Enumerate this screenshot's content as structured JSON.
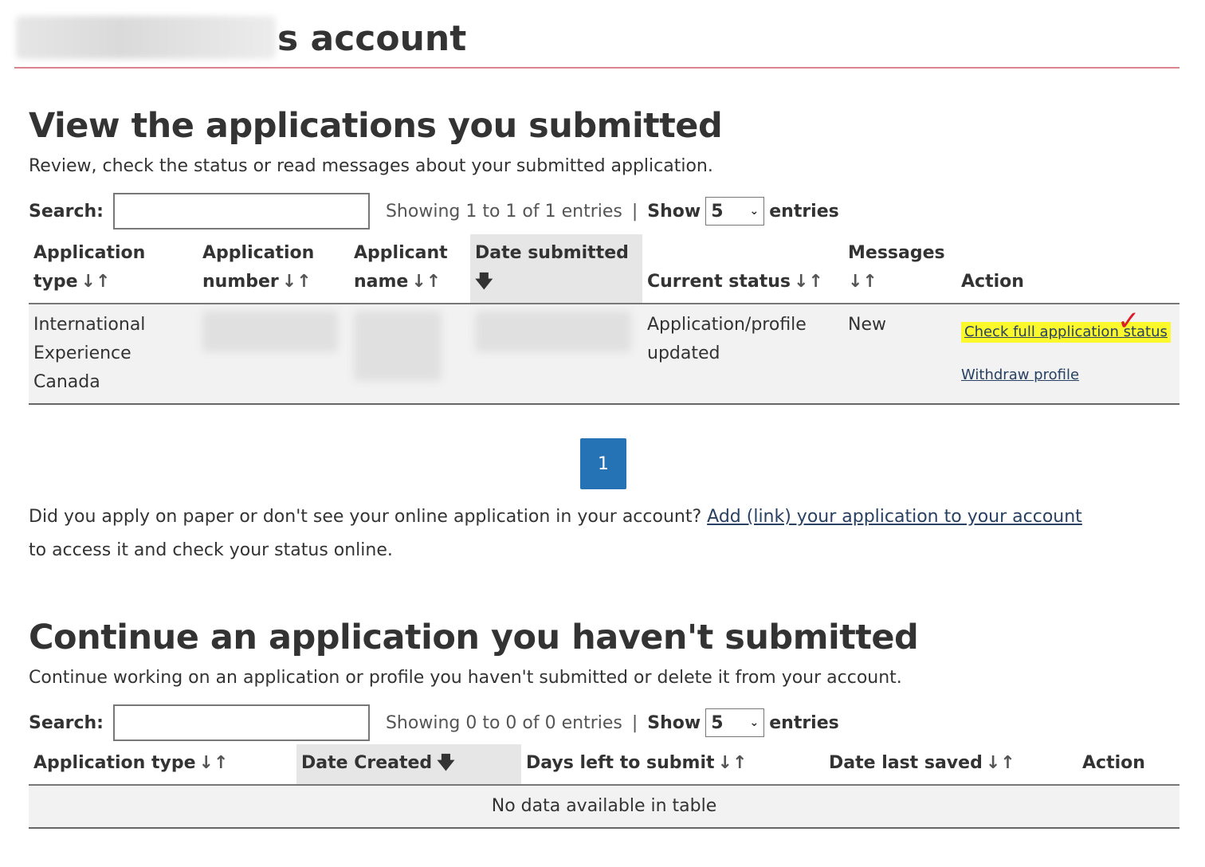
{
  "header": {
    "title_suffix": "s account"
  },
  "submitted": {
    "heading": "View the applications you submitted",
    "description": "Review, check the status or read messages about your submitted application.",
    "search_label": "Search:",
    "search_value": "",
    "showing_text": "Showing 1 to 1 of 1 entries",
    "separator": "|",
    "show_label": "Show",
    "show_value": "5",
    "entries_label": "entries",
    "columns": {
      "app_type_l1": "Application",
      "app_type_l2": "type",
      "app_number_l1": "Application",
      "app_number_l2": "number",
      "applicant_l1": "Applicant",
      "applicant_l2": "name",
      "date_submitted": "Date submitted",
      "current_status": "Current status",
      "messages": "Messages",
      "action": "Action"
    },
    "row": {
      "app_type": [
        "International",
        "Experience",
        "Canada"
      ],
      "status": [
        "Application/profile",
        "updated"
      ],
      "messages": "New",
      "action_check": "Check full application status",
      "action_withdraw": "Withdraw profile"
    },
    "page_number": "1",
    "paper_text": "Did you apply on paper or don't see your online application in your account?",
    "paper_link": "Add (link) your application to your account",
    "paper_suffix": "to access it and check your status online."
  },
  "unsubmitted": {
    "heading": "Continue an application you haven't submitted",
    "description": "Continue working on an application or profile you haven't submitted or delete it from your account.",
    "search_label": "Search:",
    "search_value": "",
    "showing_text": "Showing 0 to 0 of 0 entries",
    "separator": "|",
    "show_label": "Show",
    "show_value": "5",
    "entries_label": "entries",
    "columns": {
      "app_type": "Application type",
      "date_created": "Date Created",
      "days_left": "Days left to submit",
      "date_last_saved": "Date last saved",
      "action": "Action"
    },
    "empty_text": "No data available in table"
  },
  "icons": {
    "sort": "sort-both-icon",
    "sorted_desc": "arrow-down-icon",
    "select": "chevron-down-icon",
    "annotation": "checkmark-icon"
  },
  "colors": {
    "accent_rule": "#d9848f",
    "link": "#284162",
    "pagination": "#2572b4",
    "highlight": "#fbf82b",
    "annotation": "#d9202a"
  }
}
